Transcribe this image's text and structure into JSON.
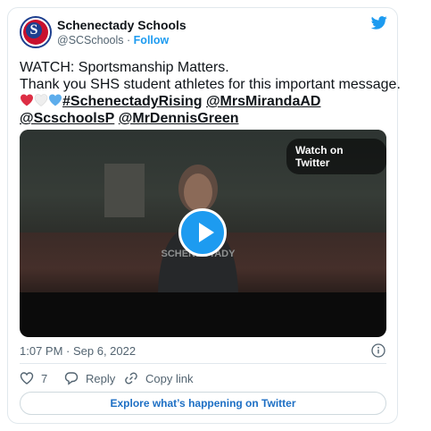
{
  "account": {
    "name": "Schenectady Schools",
    "handle": "@SCSchools",
    "separator": "·",
    "follow_label": "Follow",
    "avatar_letter": "S"
  },
  "tweet": {
    "line1": "WATCH: Sportsmanship Matters.",
    "line2": "Thank you SHS student athletes for this important message.",
    "hashtag": "#SchenectadyRising",
    "mention1": "@MrsMirandaAD",
    "mention2": "@ScschoolsP",
    "mention3": "@MrDennisGreen",
    "emoji_icons": [
      "red-heart-icon",
      "white-heart-icon",
      "blue-heart-icon"
    ]
  },
  "video": {
    "watch_label": "Watch on Twitter",
    "jersey_text": "SCHENECTADY"
  },
  "meta": {
    "timestamp": "1:07 PM · Sep 6, 2022"
  },
  "actions": {
    "like_count": "7",
    "reply_label": "Reply",
    "copy_label": "Copy link"
  },
  "footer": {
    "explore_label": "Explore what’s happening on Twitter"
  },
  "colors": {
    "accent": "#1d9bf0",
    "text": "#0f1419",
    "muted": "#536471",
    "border": "#e1e8ed"
  }
}
